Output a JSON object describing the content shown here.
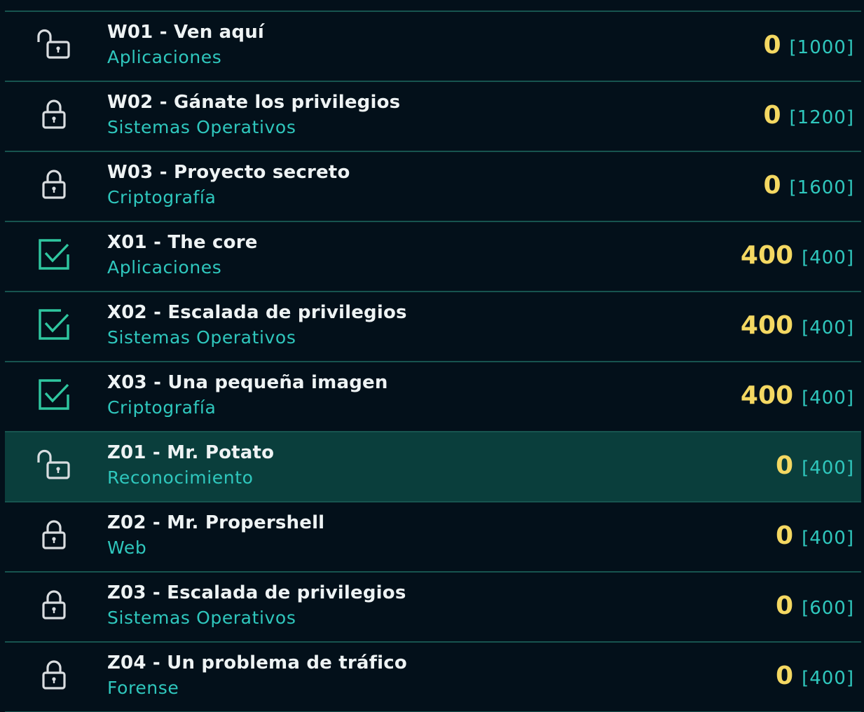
{
  "colors": {
    "background": "#03101a",
    "row_selected": "#0a3e3c",
    "divider": "#17544f",
    "title": "#eef3f4",
    "category": "#2fc7bd",
    "score": "#f4d862",
    "completed_icon": "#2fc7a0",
    "lock_icon": "#d9dde0"
  },
  "challenges": [
    {
      "title": "W01 - Ven aquí",
      "category": "Aplicaciones",
      "score": "0",
      "max": "[1000]",
      "status": "unlocked",
      "icon": "unlocked-padlock-icon",
      "selected": false
    },
    {
      "title": "W02 - Gánate los privilegios",
      "category": "Sistemas Operativos",
      "score": "0",
      "max": "[1200]",
      "status": "locked",
      "icon": "padlock-icon",
      "selected": false
    },
    {
      "title": "W03 - Proyecto secreto",
      "category": "Criptografía",
      "score": "0",
      "max": "[1600]",
      "status": "locked",
      "icon": "padlock-icon",
      "selected": false
    },
    {
      "title": "X01 - The core",
      "category": "Aplicaciones",
      "score": "400",
      "max": "[400]",
      "status": "completed",
      "icon": "checkbox-checked-icon",
      "selected": false
    },
    {
      "title": "X02 - Escalada de privilegios",
      "category": "Sistemas Operativos",
      "score": "400",
      "max": "[400]",
      "status": "completed",
      "icon": "checkbox-checked-icon",
      "selected": false
    },
    {
      "title": "X03 - Una pequeña imagen",
      "category": "Criptografía",
      "score": "400",
      "max": "[400]",
      "status": "completed",
      "icon": "checkbox-checked-icon",
      "selected": false
    },
    {
      "title": "Z01 - Mr. Potato",
      "category": "Reconocimiento",
      "score": "0",
      "max": "[400]",
      "status": "unlocked",
      "icon": "unlocked-padlock-icon",
      "selected": true
    },
    {
      "title": "Z02 - Mr. Propershell",
      "category": "Web",
      "score": "0",
      "max": "[400]",
      "status": "locked",
      "icon": "padlock-icon",
      "selected": false
    },
    {
      "title": "Z03 - Escalada de privilegios",
      "category": "Sistemas Operativos",
      "score": "0",
      "max": "[600]",
      "status": "locked",
      "icon": "padlock-icon",
      "selected": false
    },
    {
      "title": "Z04 - Un problema de tráfico",
      "category": "Forense",
      "score": "0",
      "max": "[400]",
      "status": "locked",
      "icon": "padlock-icon",
      "selected": false
    }
  ]
}
